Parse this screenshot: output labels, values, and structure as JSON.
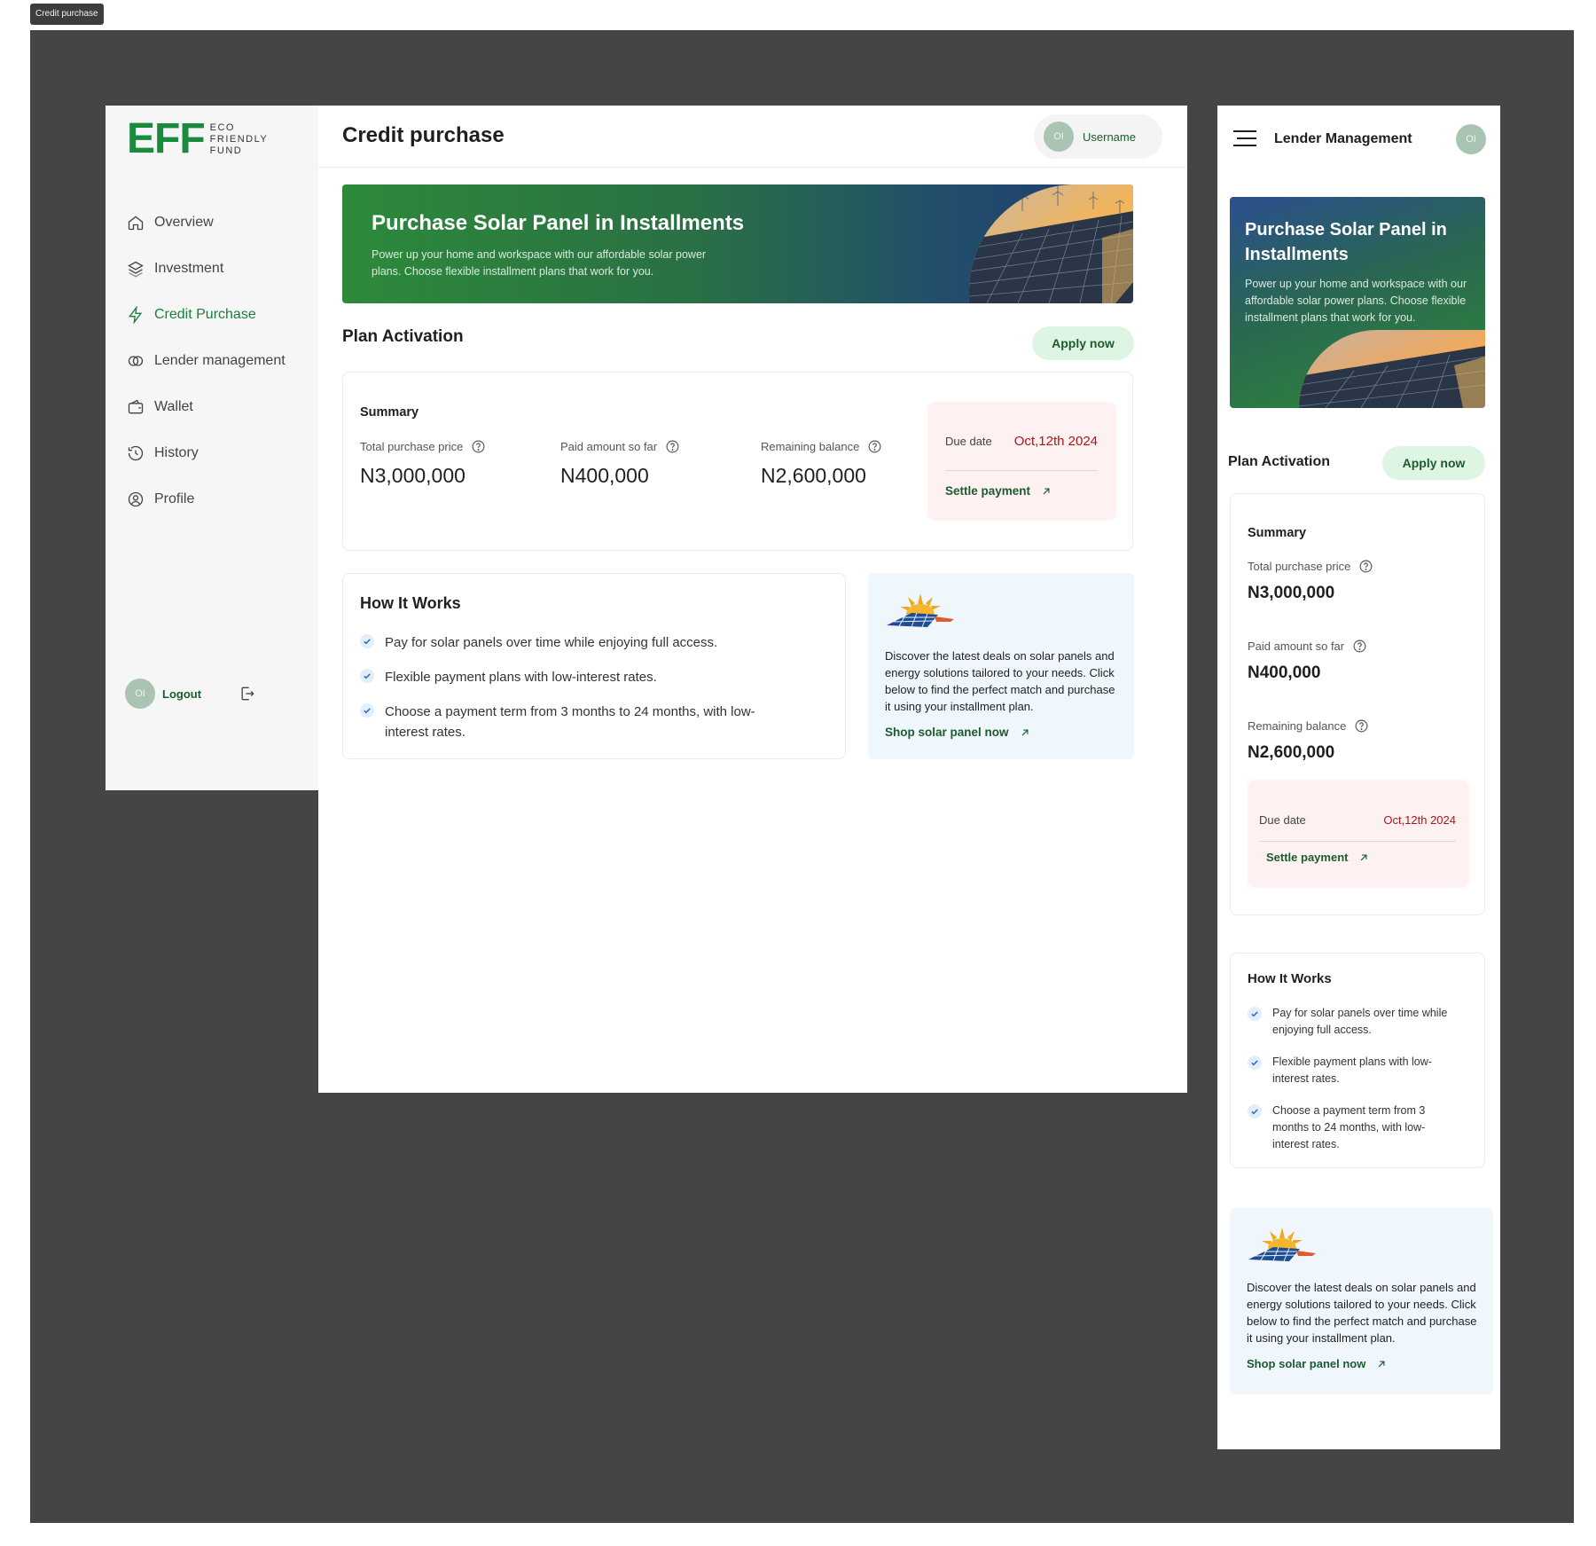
{
  "frame_tag": "Credit purchase",
  "logo": {
    "mark": "EFF",
    "line1": "ECO",
    "line2": "FRIENDLY",
    "line3": "FUND"
  },
  "nav": [
    {
      "label": "Overview",
      "icon": "home-icon"
    },
    {
      "label": "Investment",
      "icon": "layers-icon"
    },
    {
      "label": "Credit Purchase",
      "icon": "lightning-icon",
      "active": true
    },
    {
      "label": "Lender management",
      "icon": "coins-icon"
    },
    {
      "label": "Wallet",
      "icon": "wallet-icon"
    },
    {
      "label": "History",
      "icon": "history-icon"
    },
    {
      "label": "Profile",
      "icon": "user-circle-icon"
    }
  ],
  "user": {
    "initials": "OI",
    "name": "Username"
  },
  "logout_label": "Logout",
  "page_title": "Credit purchase",
  "hero": {
    "title": "Purchase Solar Panel in Installments",
    "subtitle": "Power up your home and workspace with our affordable solar power plans. Choose flexible installment plans that work for you."
  },
  "plan": {
    "title": "Plan Activation",
    "apply": "Apply now"
  },
  "summary": {
    "title": "Summary",
    "total_label": "Total purchase price",
    "total_value": "N3,000,000",
    "paid_label": "Paid amount so far",
    "paid_value": "N400,000",
    "remaining_label": "Remaining balance",
    "remaining_value": "N2,600,000",
    "due_label": "Due date",
    "due_value": "Oct,12th 2024",
    "settle": "Settle payment"
  },
  "how": {
    "title": "How It Works",
    "items": [
      "Pay for solar panels over time while enjoying full access.",
      "Flexible payment plans with low-interest rates.",
      "Choose a payment term from 3 months to 24 months, with low-interest rates."
    ]
  },
  "promo": {
    "text": "Discover the latest deals on solar panels and energy solutions tailored to your needs. Click below to find the perfect match and purchase it using your installment plan.",
    "link": "Shop solar panel now"
  },
  "mobile": {
    "title": "Lender Management"
  },
  "colors": {
    "brand_green": "#1a8a3c",
    "dark_green": "#1c5a2f",
    "due_red": "#b0141a",
    "canvas": "#454545"
  }
}
